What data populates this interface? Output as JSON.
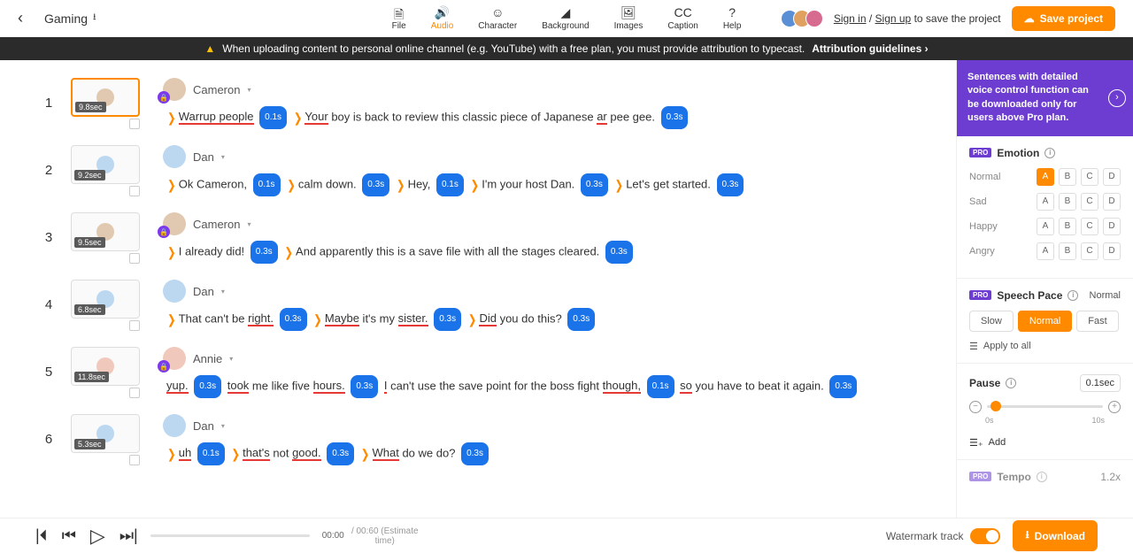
{
  "header": {
    "project_title": "Gaming",
    "menus": [
      "File",
      "Audio",
      "Character",
      "Background",
      "Images",
      "Caption",
      "Help"
    ],
    "active_menu": 1,
    "signin_pre": "Sign in",
    "signin_sep": " / ",
    "signup": "Sign up",
    "signin_post": " to save the project",
    "save_btn": "Save project"
  },
  "banner": {
    "text": "When uploading content to personal online channel (e.g. YouTube) with a free plan, you must provide attribution to typecast.",
    "attr": "Attribution guidelines"
  },
  "blocks": [
    {
      "n": "1",
      "time": "9.8sec",
      "selected": true,
      "speaker": "Cameron",
      "avatar_bg": "#e0c9b0",
      "locked": true,
      "segments": [
        {
          "chev": true,
          "runs": [
            {
              "t": "Warrup people",
              "u": true
            }
          ]
        },
        {
          "pill": "0.1s",
          "solid": true
        },
        {
          "chev": true,
          "runs": [
            {
              "t": "Your",
              "u": true
            },
            {
              "t": " boy is back to review this classic piece of Japanese "
            },
            {
              "t": "ar",
              "u": true
            },
            {
              "t": " pee gee."
            }
          ]
        },
        {
          "pill": "0.3s",
          "solid": true
        }
      ]
    },
    {
      "n": "2",
      "time": "9.2sec",
      "speaker": "Dan",
      "avatar_bg": "#bcd7f0",
      "segments": [
        {
          "chev": true,
          "runs": [
            {
              "t": "Ok Cameron,"
            }
          ]
        },
        {
          "pill": "0.1s",
          "solid": true
        },
        {
          "chev": true,
          "runs": [
            {
              "t": "calm down."
            }
          ]
        },
        {
          "pill": "0.3s",
          "solid": true
        },
        {
          "chev": true,
          "runs": [
            {
              "t": "Hey,"
            }
          ]
        },
        {
          "pill": "0.1s",
          "solid": true
        },
        {
          "chev": true,
          "runs": [
            {
              "t": "I'm your host Dan."
            }
          ]
        },
        {
          "pill": "0.3s",
          "solid": true
        },
        {
          "chev": true,
          "runs": [
            {
              "t": "Let's get started."
            }
          ]
        },
        {
          "pill": "0.3s",
          "solid": true
        }
      ]
    },
    {
      "n": "3",
      "time": "9.5sec",
      "speaker": "Cameron",
      "avatar_bg": "#e0c9b0",
      "locked": true,
      "segments": [
        {
          "chev": true,
          "runs": [
            {
              "t": "I already did!"
            }
          ]
        },
        {
          "pill": "0.3s",
          "solid": true
        },
        {
          "chev": true,
          "runs": [
            {
              "t": "And apparently this is a save file with all the stages cleared."
            }
          ]
        },
        {
          "pill": "0.3s",
          "solid": true
        }
      ]
    },
    {
      "n": "4",
      "time": "6.8sec",
      "speaker": "Dan",
      "avatar_bg": "#bcd7f0",
      "segments": [
        {
          "chev": true,
          "runs": [
            {
              "t": "That can't be "
            },
            {
              "t": "right.",
              "u": true
            }
          ]
        },
        {
          "pill": "0.3s",
          "solid": true
        },
        {
          "chev": true,
          "runs": [
            {
              "t": "Maybe",
              "u": true
            },
            {
              "t": " it's my "
            },
            {
              "t": "sister.",
              "u": true
            }
          ]
        },
        {
          "pill": "0.3s",
          "solid": true
        },
        {
          "chev": true,
          "runs": [
            {
              "t": "Did",
              "u": true
            },
            {
              "t": " you do this?"
            }
          ]
        },
        {
          "pill": "0.3s",
          "solid": true
        }
      ]
    },
    {
      "n": "5",
      "time": "11.8sec",
      "speaker": "Annie",
      "avatar_bg": "#f0c9bc",
      "locked": true,
      "segments": [
        {
          "runs": [
            {
              "t": "yup.",
              "u": true
            }
          ]
        },
        {
          "pill": "0.3s",
          "solid": true
        },
        {
          "runs": [
            {
              "t": "took",
              "u": true
            },
            {
              "t": " me like five "
            },
            {
              "t": "hours.",
              "u": true
            }
          ]
        },
        {
          "pill": "0.3s",
          "solid": true
        },
        {
          "runs": [
            {
              "t": "I",
              "u": true
            },
            {
              "t": " can't use the save point for the boss fight "
            },
            {
              "t": "though,",
              "u": true
            }
          ]
        },
        {
          "pill": "0.1s",
          "solid": true
        },
        {
          "runs": [
            {
              "t": "so",
              "u": true
            },
            {
              "t": " you have to beat it again."
            }
          ]
        },
        {
          "pill": "0.3s",
          "solid": true
        }
      ]
    },
    {
      "n": "6",
      "time": "5.3sec",
      "speaker": "Dan",
      "avatar_bg": "#bcd7f0",
      "segments": [
        {
          "chev": true,
          "runs": [
            {
              "t": "uh",
              "u": true
            }
          ]
        },
        {
          "pill": "0.1s",
          "solid": true
        },
        {
          "chev": true,
          "runs": [
            {
              "t": "that's",
              "u": true
            },
            {
              "t": " not "
            },
            {
              "t": "good.",
              "u": true
            }
          ]
        },
        {
          "pill": "0.3s",
          "solid": true
        },
        {
          "chev": true,
          "runs": [
            {
              "t": "What",
              "u": true
            },
            {
              "t": " do we do?"
            }
          ]
        },
        {
          "pill": "0.3s",
          "solid": true
        }
      ]
    }
  ],
  "sidebar": {
    "notice": "Sentences with detailed voice control function can be downloaded only for users above Pro plan.",
    "emotion_title": "Emotion",
    "emotions": [
      {
        "label": "Normal",
        "active": 0
      },
      {
        "label": "Sad",
        "active": -1
      },
      {
        "label": "Happy",
        "active": -1
      },
      {
        "label": "Angry",
        "active": -1
      }
    ],
    "emotion_btns": [
      "A",
      "B",
      "C",
      "D"
    ],
    "pace_title": "Speech Pace",
    "pace_current": "Normal",
    "pace_opts": [
      "Slow",
      "Normal",
      "Fast"
    ],
    "pace_active": 1,
    "apply_all": "Apply to all",
    "pause_title": "Pause",
    "pause_val": "0.1sec",
    "pause_min": "0s",
    "pause_max": "10s",
    "add": "Add",
    "tempo_title": "Tempo",
    "tempo_val": "1.2x"
  },
  "player": {
    "current": "00:00",
    "total": "/ 00:60 (Estimate time)",
    "watermark": "Watermark track",
    "download": "Download"
  }
}
